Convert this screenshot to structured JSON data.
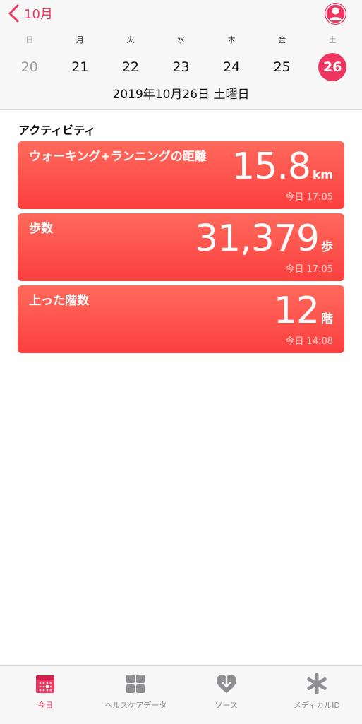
{
  "header": {
    "back_label": "10月",
    "weekdays": [
      "日",
      "月",
      "火",
      "水",
      "木",
      "金",
      "土"
    ],
    "days": [
      "20",
      "21",
      "22",
      "23",
      "24",
      "25",
      "26"
    ],
    "selected_day_index": 6,
    "date_label": "2019年10月26日 土曜日"
  },
  "section": {
    "title": "アクティビティ"
  },
  "cards": [
    {
      "title": "ウォーキング+ランニングの距離",
      "value": "15.8",
      "unit": "km",
      "time": "今日 17:05"
    },
    {
      "title": "歩数",
      "value": "31,379",
      "unit": "歩",
      "time": "今日 17:05"
    },
    {
      "title": "上った階数",
      "value": "12",
      "unit": "階",
      "time": "今日 14:08"
    }
  ],
  "tabs": [
    {
      "label": "今日",
      "icon": "calendar-icon"
    },
    {
      "label": "ヘルスケアデータ",
      "icon": "grid-icon"
    },
    {
      "label": "ソース",
      "icon": "heart-download-icon"
    },
    {
      "label": "メディカルID",
      "icon": "asterisk-icon"
    }
  ],
  "colors": {
    "accent": "#ee3660",
    "card_top": "#ff6a5c",
    "card_bottom": "#fc3f3f",
    "tab_inactive": "#8e8e93"
  }
}
